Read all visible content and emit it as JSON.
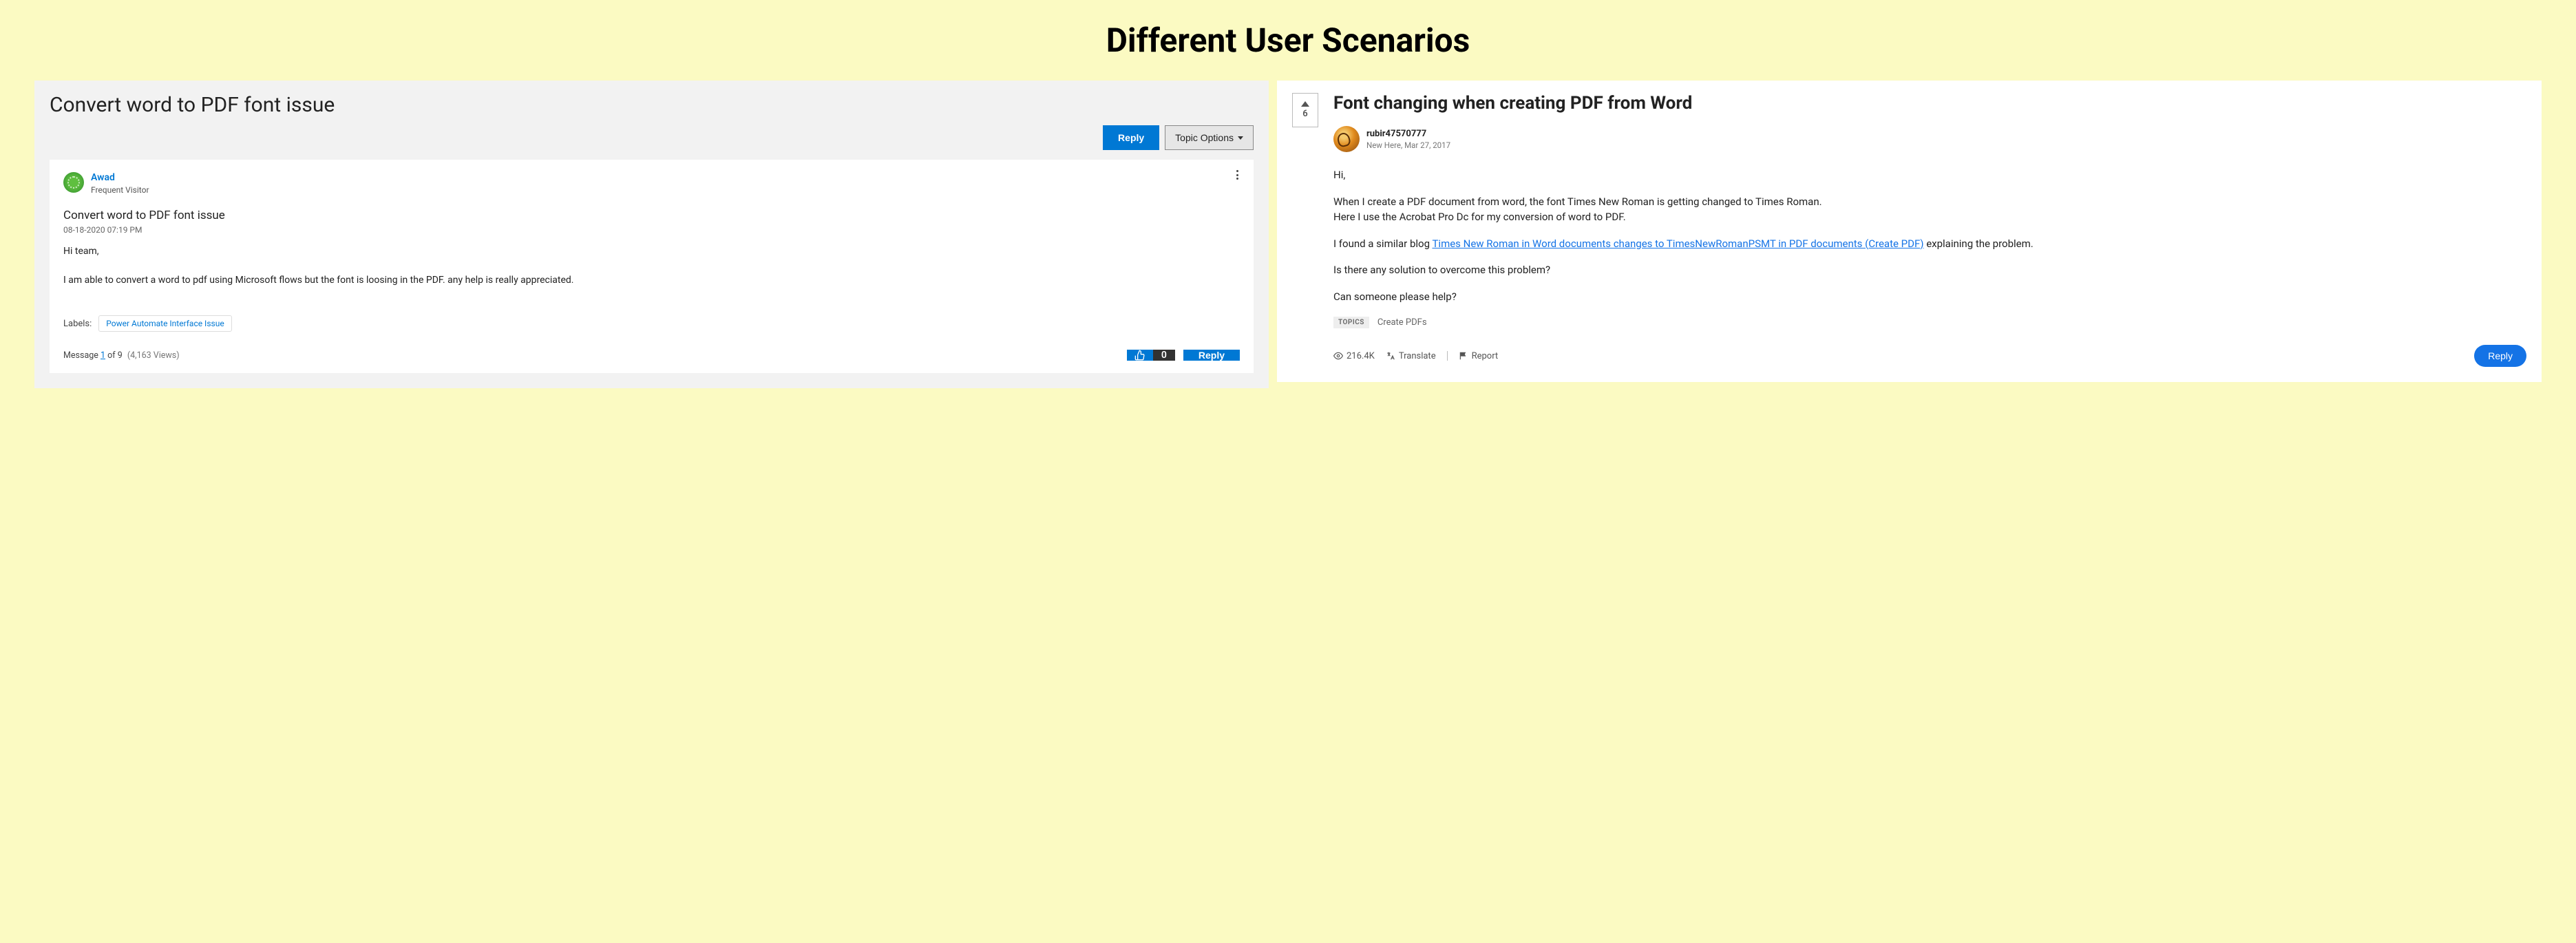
{
  "page_title": "Different User Scenarios",
  "left": {
    "title": "Convert word to PDF font issue",
    "reply_label": "Reply",
    "topic_options_label": "Topic Options",
    "user": {
      "name": "Awad",
      "role": "Frequent Visitor"
    },
    "post_title": "Convert word to PDF font issue",
    "post_date": "08-18-2020 07:19 PM",
    "body_line1": "Hi team,",
    "body_line2": "I am able to convert a word to pdf using Microsoft flows but the font is loosing in the PDF. any help is really appreciated.",
    "labels_label": "Labels:",
    "label_chip": "Power Automate Interface Issue",
    "message_prefix": "Message ",
    "message_number": "1",
    "message_of": " of 9",
    "views": "  (4,163 Views)",
    "thumb_count": "0",
    "reply2_label": "Reply"
  },
  "right": {
    "upvote_count": "6",
    "title": "Font changing when creating PDF from Word",
    "user": {
      "name": "rubir47570777",
      "meta": "New Here, Mar 27, 2017"
    },
    "body_p1": "Hi,",
    "body_p2a": "When I create a PDF document from word, the font Times New Roman is getting changed to Times Roman.",
    "body_p2b": "Here I use the Acrobat Pro Dc for my conversion of word to PDF.",
    "body_p3_pre": "I found a similar blog ",
    "body_p3_link": "Times New Roman in Word documents changes to TimesNewRomanPSMT in PDF documents (Create PDF)",
    "body_p3_post": "  explaining the problem.",
    "body_p4": "Is there any solution to overcome this problem?",
    "body_p5": "Can someone please help?",
    "topics_label": "TOPICS",
    "topics_value": "Create PDFs",
    "views": "216.4K",
    "translate": "Translate",
    "report": "Report",
    "reply_label": "Reply"
  }
}
